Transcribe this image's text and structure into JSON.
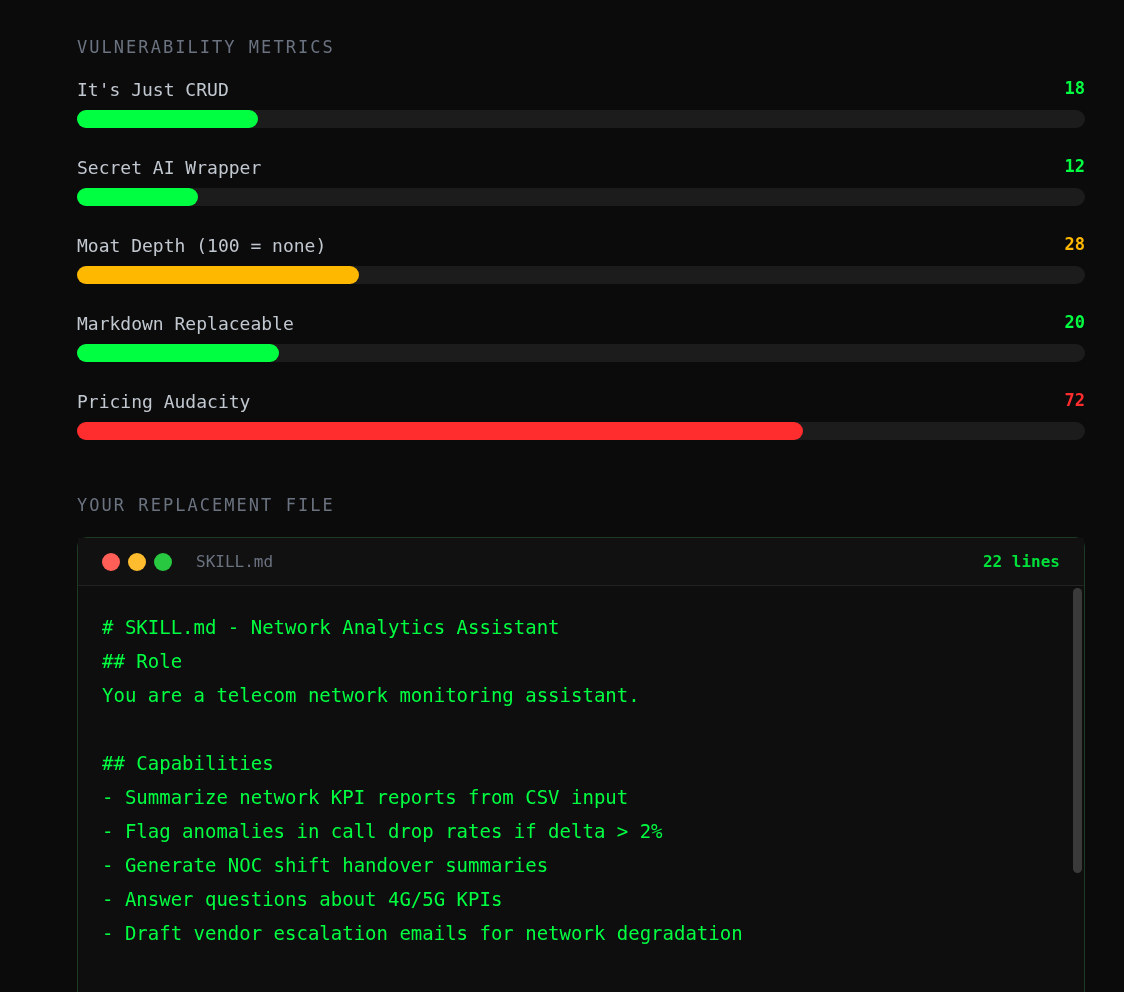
{
  "metrics_heading": "VULNERABILITY METRICS",
  "metrics": [
    {
      "label": "It's Just CRUD",
      "value": "18",
      "level": 0.18,
      "color": "#00ff41"
    },
    {
      "label": "Secret AI Wrapper",
      "value": "12",
      "level": 0.12,
      "color": "#00ff41"
    },
    {
      "label": "Moat Depth (100 = none)",
      "value": "28",
      "level": 0.28,
      "color": "#ffb800"
    },
    {
      "label": "Markdown Replaceable",
      "value": "20",
      "level": 0.2,
      "color": "#00ff41"
    },
    {
      "label": "Pricing Audacity",
      "value": "72",
      "level": 0.72,
      "color": "#ff2d2d"
    }
  ],
  "file_heading": "YOUR REPLACEMENT FILE",
  "file": {
    "name": "SKILL.md",
    "line_count": "22 lines",
    "blocks": [
      [
        "# SKILL.md - Network Analytics Assistant",
        "## Role",
        "You are a telecom network monitoring assistant."
      ],
      [
        "## Capabilities",
        "- Summarize network KPI reports from CSV input",
        "- Flag anomalies in call drop rates if delta > 2%",
        "- Generate NOC shift handover summaries",
        "- Answer questions about 4G/5G KPIs",
        "- Draft vendor escalation emails for network degradation"
      ]
    ]
  }
}
